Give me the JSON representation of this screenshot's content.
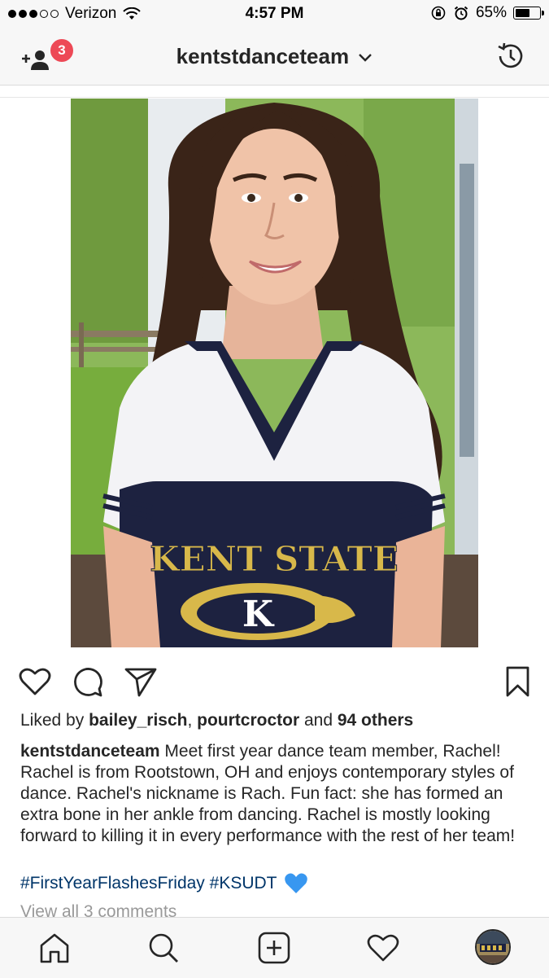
{
  "status_bar": {
    "carrier": "Verizon",
    "time": "4:57 PM",
    "battery": "65%",
    "battery_level": 0.65,
    "signal_dots_filled": 3,
    "signal_dots_total": 5
  },
  "header": {
    "title": "kentstdanceteam",
    "notification_count": "3",
    "left_icon": "add-user-icon",
    "right_icon": "history-icon"
  },
  "post": {
    "photo": "photo of a smiling woman with long dark wavy hair wearing a navy and white Kent State golden flashes t-shirt on a porch",
    "shirt_text": "KENT STATE",
    "liked_by_prefix": "Liked by ",
    "liked_by_user1": "bailey_risch",
    "liked_by_sep": ", ",
    "liked_by_user2": "pourtcroctor",
    "liked_by_and": " and ",
    "liked_by_others": "94 others",
    "caption_user": "kentstdanceteam",
    "caption_text": " Meet first year dance team member, Rachel! Rachel is from Rootstown, OH and enjoys contemporary styles of dance. Rachel's nickname is Rach. Fun fact: she has formed an extra bone in her ankle from dancing. Rachel is mostly looking forward to killing it in every performance with the rest of her team!",
    "hashtags": "#FirstYearFlashesFriday #KSUDT",
    "emoji": "blue-heart-icon",
    "view_comments": "View all 3 comments"
  },
  "colors": {
    "badge": "#ed4956",
    "hashtag": "#003569",
    "heart": "#3897f0",
    "muted": "#999999"
  },
  "tabbar": {
    "items": [
      "home-icon",
      "search-icon",
      "new-post-icon",
      "activity-heart-icon",
      "profile-avatar"
    ]
  }
}
